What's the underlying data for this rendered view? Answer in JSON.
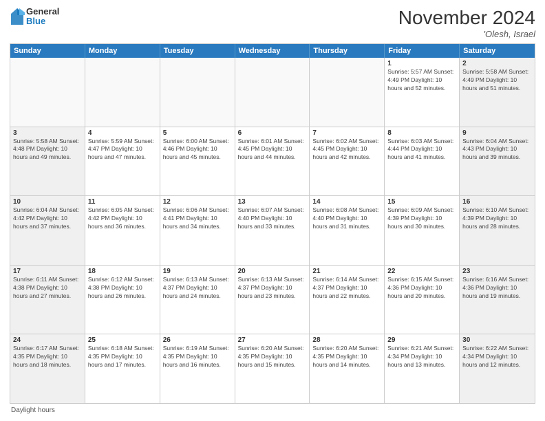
{
  "header": {
    "logo_general": "General",
    "logo_blue": "Blue",
    "month_title": "November 2024",
    "location": "'Olesh, Israel"
  },
  "footer": {
    "daylight_label": "Daylight hours"
  },
  "weekdays": [
    "Sunday",
    "Monday",
    "Tuesday",
    "Wednesday",
    "Thursday",
    "Friday",
    "Saturday"
  ],
  "rows": [
    [
      {
        "day": "",
        "info": ""
      },
      {
        "day": "",
        "info": ""
      },
      {
        "day": "",
        "info": ""
      },
      {
        "day": "",
        "info": ""
      },
      {
        "day": "",
        "info": ""
      },
      {
        "day": "1",
        "info": "Sunrise: 5:57 AM\nSunset: 4:49 PM\nDaylight: 10 hours and 52 minutes."
      },
      {
        "day": "2",
        "info": "Sunrise: 5:58 AM\nSunset: 4:49 PM\nDaylight: 10 hours and 51 minutes."
      }
    ],
    [
      {
        "day": "3",
        "info": "Sunrise: 5:58 AM\nSunset: 4:48 PM\nDaylight: 10 hours and 49 minutes."
      },
      {
        "day": "4",
        "info": "Sunrise: 5:59 AM\nSunset: 4:47 PM\nDaylight: 10 hours and 47 minutes."
      },
      {
        "day": "5",
        "info": "Sunrise: 6:00 AM\nSunset: 4:46 PM\nDaylight: 10 hours and 45 minutes."
      },
      {
        "day": "6",
        "info": "Sunrise: 6:01 AM\nSunset: 4:45 PM\nDaylight: 10 hours and 44 minutes."
      },
      {
        "day": "7",
        "info": "Sunrise: 6:02 AM\nSunset: 4:45 PM\nDaylight: 10 hours and 42 minutes."
      },
      {
        "day": "8",
        "info": "Sunrise: 6:03 AM\nSunset: 4:44 PM\nDaylight: 10 hours and 41 minutes."
      },
      {
        "day": "9",
        "info": "Sunrise: 6:04 AM\nSunset: 4:43 PM\nDaylight: 10 hours and 39 minutes."
      }
    ],
    [
      {
        "day": "10",
        "info": "Sunrise: 6:04 AM\nSunset: 4:42 PM\nDaylight: 10 hours and 37 minutes."
      },
      {
        "day": "11",
        "info": "Sunrise: 6:05 AM\nSunset: 4:42 PM\nDaylight: 10 hours and 36 minutes."
      },
      {
        "day": "12",
        "info": "Sunrise: 6:06 AM\nSunset: 4:41 PM\nDaylight: 10 hours and 34 minutes."
      },
      {
        "day": "13",
        "info": "Sunrise: 6:07 AM\nSunset: 4:40 PM\nDaylight: 10 hours and 33 minutes."
      },
      {
        "day": "14",
        "info": "Sunrise: 6:08 AM\nSunset: 4:40 PM\nDaylight: 10 hours and 31 minutes."
      },
      {
        "day": "15",
        "info": "Sunrise: 6:09 AM\nSunset: 4:39 PM\nDaylight: 10 hours and 30 minutes."
      },
      {
        "day": "16",
        "info": "Sunrise: 6:10 AM\nSunset: 4:39 PM\nDaylight: 10 hours and 28 minutes."
      }
    ],
    [
      {
        "day": "17",
        "info": "Sunrise: 6:11 AM\nSunset: 4:38 PM\nDaylight: 10 hours and 27 minutes."
      },
      {
        "day": "18",
        "info": "Sunrise: 6:12 AM\nSunset: 4:38 PM\nDaylight: 10 hours and 26 minutes."
      },
      {
        "day": "19",
        "info": "Sunrise: 6:13 AM\nSunset: 4:37 PM\nDaylight: 10 hours and 24 minutes."
      },
      {
        "day": "20",
        "info": "Sunrise: 6:13 AM\nSunset: 4:37 PM\nDaylight: 10 hours and 23 minutes."
      },
      {
        "day": "21",
        "info": "Sunrise: 6:14 AM\nSunset: 4:37 PM\nDaylight: 10 hours and 22 minutes."
      },
      {
        "day": "22",
        "info": "Sunrise: 6:15 AM\nSunset: 4:36 PM\nDaylight: 10 hours and 20 minutes."
      },
      {
        "day": "23",
        "info": "Sunrise: 6:16 AM\nSunset: 4:36 PM\nDaylight: 10 hours and 19 minutes."
      }
    ],
    [
      {
        "day": "24",
        "info": "Sunrise: 6:17 AM\nSunset: 4:35 PM\nDaylight: 10 hours and 18 minutes."
      },
      {
        "day": "25",
        "info": "Sunrise: 6:18 AM\nSunset: 4:35 PM\nDaylight: 10 hours and 17 minutes."
      },
      {
        "day": "26",
        "info": "Sunrise: 6:19 AM\nSunset: 4:35 PM\nDaylight: 10 hours and 16 minutes."
      },
      {
        "day": "27",
        "info": "Sunrise: 6:20 AM\nSunset: 4:35 PM\nDaylight: 10 hours and 15 minutes."
      },
      {
        "day": "28",
        "info": "Sunrise: 6:20 AM\nSunset: 4:35 PM\nDaylight: 10 hours and 14 minutes."
      },
      {
        "day": "29",
        "info": "Sunrise: 6:21 AM\nSunset: 4:34 PM\nDaylight: 10 hours and 13 minutes."
      },
      {
        "day": "30",
        "info": "Sunrise: 6:22 AM\nSunset: 4:34 PM\nDaylight: 10 hours and 12 minutes."
      }
    ]
  ]
}
